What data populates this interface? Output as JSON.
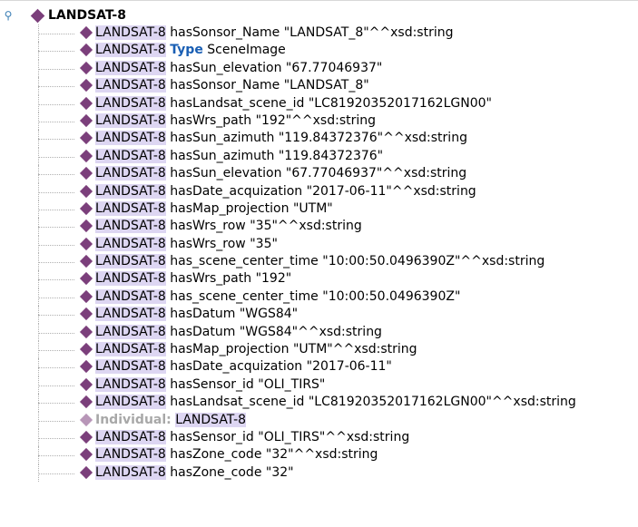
{
  "root": {
    "toggle_icon": "collapse-pin-icon",
    "label": "LANDSAT-8",
    "icon": "individual-diamond-icon"
  },
  "assertions": [
    {
      "subject": "LANDSAT-8",
      "predicate": "hasSonsor_Name",
      "value": "\"LANDSAT_8\"^^xsd:string"
    },
    {
      "subject": "LANDSAT-8",
      "keyword": "Type",
      "value": "SceneImage"
    },
    {
      "subject": "LANDSAT-8",
      "predicate": "hasSun_elevation",
      "value": "\"67.77046937\""
    },
    {
      "subject": "LANDSAT-8",
      "predicate": "hasSonsor_Name",
      "value": "\"LANDSAT_8\""
    },
    {
      "subject": "LANDSAT-8",
      "predicate": "hasLandsat_scene_id",
      "value": "\"LC81920352017162LGN00\""
    },
    {
      "subject": "LANDSAT-8",
      "predicate": "hasWrs_path",
      "value": "\"192\"^^xsd:string"
    },
    {
      "subject": "LANDSAT-8",
      "predicate": "hasSun_azimuth",
      "value": "\"119.84372376\"^^xsd:string"
    },
    {
      "subject": "LANDSAT-8",
      "predicate": "hasSun_azimuth",
      "value": "\"119.84372376\""
    },
    {
      "subject": "LANDSAT-8",
      "predicate": "hasSun_elevation",
      "value": "\"67.77046937\"^^xsd:string"
    },
    {
      "subject": "LANDSAT-8",
      "predicate": "hasDate_acquization",
      "value": "\"2017-06-11\"^^xsd:string"
    },
    {
      "subject": "LANDSAT-8",
      "predicate": "hasMap_projection",
      "value": "\"UTM\""
    },
    {
      "subject": "LANDSAT-8",
      "predicate": "hasWrs_row",
      "value": "\"35\"^^xsd:string"
    },
    {
      "subject": "LANDSAT-8",
      "predicate": "hasWrs_row",
      "value": "\"35\""
    },
    {
      "subject": "LANDSAT-8",
      "predicate": "has_scene_center_time",
      "value": "\"10:00:50.0496390Z\"^^xsd:string"
    },
    {
      "subject": "LANDSAT-8",
      "predicate": "hasWrs_path",
      "value": "\"192\""
    },
    {
      "subject": "LANDSAT-8",
      "predicate": "has_scene_center_time",
      "value": "\"10:00:50.0496390Z\""
    },
    {
      "subject": "LANDSAT-8",
      "predicate": "hasDatum",
      "value": "\"WGS84\""
    },
    {
      "subject": "LANDSAT-8",
      "predicate": "hasDatum",
      "value": "\"WGS84\"^^xsd:string"
    },
    {
      "subject": "LANDSAT-8",
      "predicate": "hasMap_projection",
      "value": "\"UTM\"^^xsd:string"
    },
    {
      "subject": "LANDSAT-8",
      "predicate": "hasDate_acquization",
      "value": "\"2017-06-11\""
    },
    {
      "subject": "LANDSAT-8",
      "predicate": "hasSensor_id",
      "value": "\"OLI_TIRS\""
    },
    {
      "subject": "LANDSAT-8",
      "predicate": "hasLandsat_scene_id",
      "value": "\"LC81920352017162LGN00\"^^xsd:string"
    },
    {
      "individual_label": "Individual:",
      "value_highlight": "LANDSAT-8",
      "light_icon": true
    },
    {
      "subject": "LANDSAT-8",
      "predicate": "hasSensor_id",
      "value": "\"OLI_TIRS\"^^xsd:string"
    },
    {
      "subject": "LANDSAT-8",
      "predicate": "hasZone_code",
      "value": "\"32\"^^xsd:string"
    },
    {
      "subject": "LANDSAT-8",
      "predicate": "hasZone_code",
      "value": "\"32\""
    }
  ],
  "colors": {
    "diamond": "#7b3f7b",
    "diamond_light": "#b896b8",
    "subject_highlight": "#ddd6f2",
    "type_keyword": "#1a5fb4",
    "individual_keyword": "#a8a8a8",
    "toggle": "#3b7fb5"
  }
}
